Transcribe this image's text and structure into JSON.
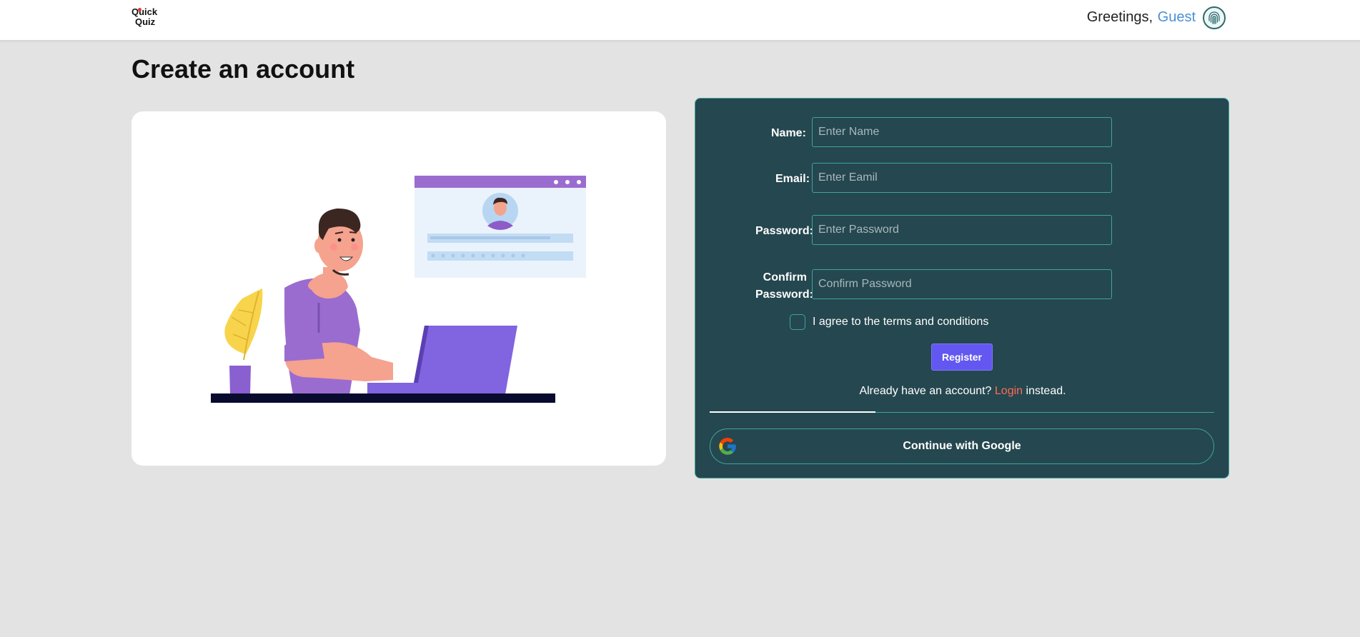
{
  "header": {
    "logo_line1": "Quick",
    "logo_line2": "Quiz",
    "greeting": "Greetings,",
    "user": "Guest",
    "profile_icon": "fingerprint-icon"
  },
  "page": {
    "title": "Create an account"
  },
  "form": {
    "name_label": "Name:",
    "name_placeholder": "Enter Name",
    "email_label": "Email:",
    "email_placeholder": "Enter Eamil",
    "password_label": "Password:",
    "password_placeholder": "Enter Password",
    "confirm_label_line1": "Confirm",
    "confirm_label_line2": "Password:",
    "confirm_placeholder": "Confirm Password",
    "terms_label": "I agree to the terms and conditions",
    "terms_checked": false,
    "register_label": "Register",
    "already_text": "Already have an account?",
    "login_link": "Login",
    "instead_text": "instead.",
    "google_label": "Continue with Google",
    "google_icon": "google-icon"
  },
  "colors": {
    "panel_bg": "#25474f",
    "panel_border": "#3fa59c",
    "register_bg": "#6257f0",
    "login_link": "#ff6b57",
    "guest": "#4a90d9",
    "page_bg": "#e3e3e3"
  }
}
